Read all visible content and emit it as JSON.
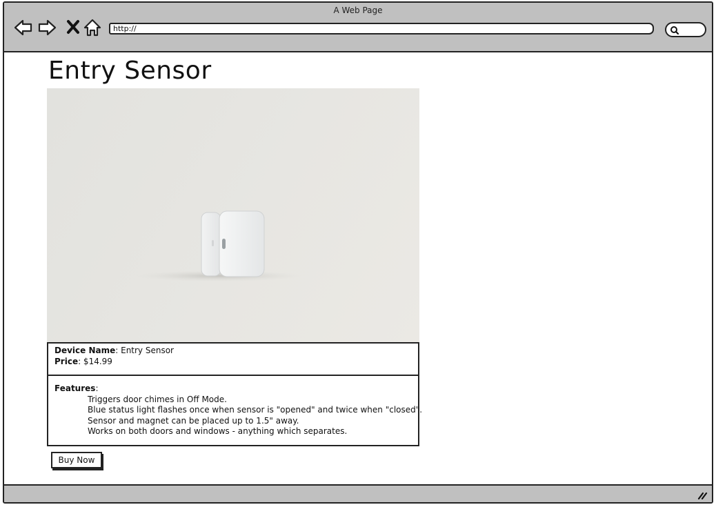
{
  "window": {
    "title": "A Web Page",
    "url": "http://"
  },
  "nav_icons": [
    "back-arrow-icon",
    "forward-arrow-icon",
    "close-x-icon",
    "home-icon"
  ],
  "search_icon": "search-icon",
  "page": {
    "title": "Entry Sensor",
    "image_icon": "entry-sensor-product-image",
    "device_name_label": "Device Name",
    "device_name_value": ": Entry Sensor",
    "price_label": "Price",
    "price_value": ": $14.99",
    "features_label": "Features",
    "features_suffix": ":",
    "features": [
      "Triggers door chimes in Off Mode.",
      "Blue status light flashes once when sensor is \"opened\" and twice when \"closed\".",
      "Sensor and magnet can be placed up to 1.5\" away.",
      "Works on both doors and windows - anything which separates."
    ],
    "buy_button": "Buy Now"
  },
  "colors": {
    "chrome": "#c0c0c0",
    "border": "#222222",
    "background": "#ffffff"
  }
}
